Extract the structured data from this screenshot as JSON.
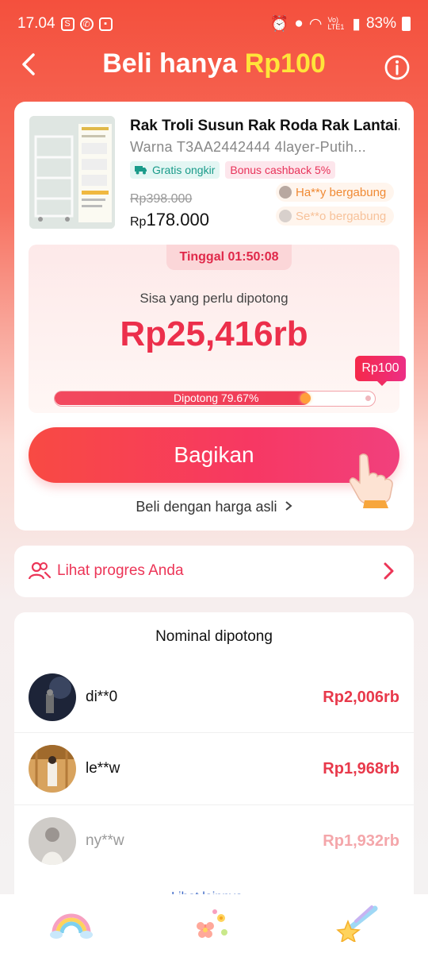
{
  "status_bar": {
    "time": "17.04",
    "battery": "83%",
    "network_label": "Vo) LTE1"
  },
  "header": {
    "title_prefix": "Beli hanya",
    "title_price": "Rp100"
  },
  "product": {
    "title": "Rak Troli Susun Rak Roda Rak Lantai...",
    "variant": "Warna T3AA2442444 4layer-Putih...",
    "tag_shipping": "Gratis ongkir",
    "tag_cashback": "Bonus cashback 5%",
    "old_price": "Rp398.000",
    "currency": "Rp",
    "new_price": "178.000",
    "joiners": [
      {
        "text": "Ha**y bergabung"
      },
      {
        "text": "Se**o bergabung"
      }
    ]
  },
  "cut": {
    "timer": "Tinggal 01:50:08",
    "remaining_label": "Sisa yang perlu dipotong",
    "remaining_amount": "Rp25,416rb",
    "goal_badge": "Rp100",
    "progress_label": "Dipotong 79.67%",
    "progress_percent": 79.67
  },
  "actions": {
    "share_label": "Bagikan",
    "buy_original": "Beli dengan harga asli"
  },
  "progress_link": {
    "label": "Lihat progres Anda"
  },
  "cut_list": {
    "title": "Nominal dipotong",
    "rows": [
      {
        "user": "di**0",
        "amount": "Rp2,006rb"
      },
      {
        "user": "le**w",
        "amount": "Rp1,968rb"
      },
      {
        "user": "ny**w",
        "amount": "Rp1,932rb"
      }
    ],
    "more_label": "Lihat lainnya"
  },
  "bottom_nav": {
    "items": [
      "rainbow-icon",
      "flowers-icon",
      "shooting-star-icon"
    ]
  },
  "colors": {
    "brand_red": "#f4503d",
    "accent_pink": "#ec2f4b",
    "title_highlight": "#ffe43a"
  }
}
